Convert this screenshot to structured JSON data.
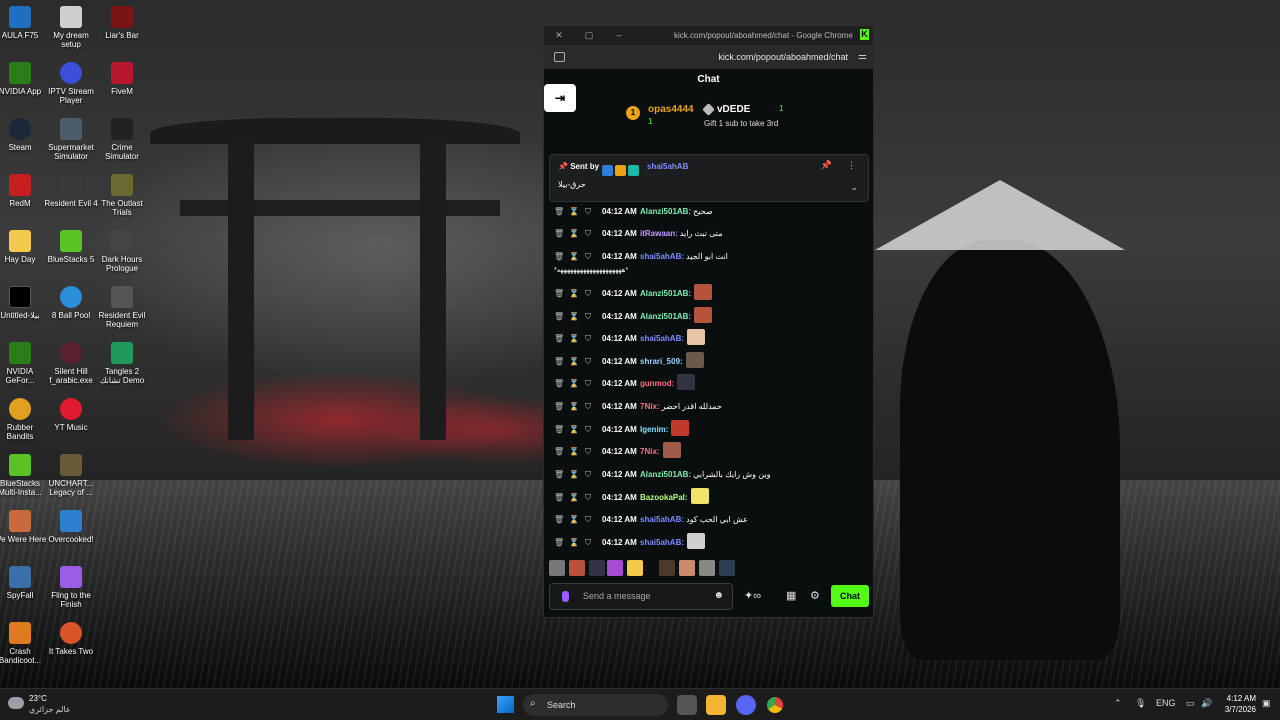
{
  "desktop": {
    "icons": [
      {
        "label": "AULA F75"
      },
      {
        "label": "My dream setup"
      },
      {
        "label": "Liar's Bar"
      },
      {
        "label": "NVIDIA App"
      },
      {
        "label": "IPTV Stream Player"
      },
      {
        "label": "FiveM"
      },
      {
        "label": "Steam"
      },
      {
        "label": "Supermarket Simulator"
      },
      {
        "label": "Crime Simulator"
      },
      {
        "label": "RedM"
      },
      {
        "label": "Resident Evil 4"
      },
      {
        "label": "The Outlast Trials"
      },
      {
        "label": "Hay Day"
      },
      {
        "label": "BlueStacks 5"
      },
      {
        "label": "Dark Hours Prologue"
      },
      {
        "label": "Untitled-بيلا"
      },
      {
        "label": "8 Ball Pool"
      },
      {
        "label": "Resident Evil Requiem"
      },
      {
        "label": "NVIDIA GeFor..."
      },
      {
        "label": "Silent Hill f_arabic.exe"
      },
      {
        "label": "Tangles 2 تشانك Demo"
      },
      {
        "label": "Rubber Bandits"
      },
      {
        "label": "YT Music"
      },
      {
        "label": "BlueStacks Multi-Insta..."
      },
      {
        "label": "UNCHART... Legacy of ..."
      },
      {
        "label": "We Were Here"
      },
      {
        "label": "Overcooked!"
      },
      {
        "label": "SpyFall"
      },
      {
        "label": "Fling to the Finish"
      },
      {
        "label": "Crash Bandicoot..."
      },
      {
        "label": "It Takes Two"
      }
    ]
  },
  "browser": {
    "window_title": "kick.com/popout/aboahmed/chat - Google Chrome",
    "url": "kick.com/popout/aboahmed/chat",
    "kick_logo": "K"
  },
  "chat": {
    "title": "Chat",
    "collapse_icon": "collapse-icon",
    "leaderboard": {
      "first_rank": "1",
      "first_name": "opas4444",
      "first_count": "1",
      "second_name": "vDEDE",
      "second_count": "1",
      "gift_text": "Gift 1 sub to take 3rd"
    },
    "pinned": {
      "sent_by_label": "Sent by",
      "sender": "shai5ahAB",
      "text": "حرق-بيلا"
    },
    "messages": [
      {
        "time": "04:12 AM",
        "user": "Alanzi501AB:",
        "text": "صحيح",
        "color": "#7cf0b0"
      },
      {
        "time": "04:12 AM",
        "user": "itRawaan:",
        "text": "متى تبث رايد",
        "color": "#c59bff"
      },
      {
        "time": "04:12 AM",
        "user": "shai5ahAB:",
        "text": "انت ابو الجيد",
        "color": "#7f8cff"
      },
      {
        "time": "04:12 AM",
        "user": "Alanzi501AB:",
        "text": "",
        "color": "#7cf0b0"
      },
      {
        "time": "04:12 AM",
        "user": "Alanzi501AB:",
        "text": "",
        "color": "#7cf0b0"
      },
      {
        "time": "04:12 AM",
        "user": "shai5ahAB:",
        "text": "",
        "color": "#7f8cff"
      },
      {
        "time": "04:12 AM",
        "user": "shrari_509:",
        "text": "",
        "color": "#9fd3ff"
      },
      {
        "time": "04:12 AM",
        "user": "gunmod:",
        "text": "",
        "color": "#ff6b8b"
      },
      {
        "time": "04:12 AM",
        "user": "7Nix:",
        "text": "حمدلله اقدر احضر",
        "color": "#ff6b8b"
      },
      {
        "time": "04:12 AM",
        "user": "Igenim:",
        "text": "",
        "color": "#7fe0ff"
      },
      {
        "time": "04:12 AM",
        "user": "7Nix:",
        "text": "",
        "color": "#ff6b8b"
      },
      {
        "time": "04:12 AM",
        "user": "Alanzi501AB:",
        "text": "وين وش رايك بالشرابي",
        "color": "#7cf0b0"
      },
      {
        "time": "04:12 AM",
        "user": "BazookaPal:",
        "text": "",
        "color": "#b6ff7a"
      },
      {
        "time": "04:12 AM",
        "user": "shai5ahAB:",
        "text": "عش ابي الحب كود",
        "color": "#7f8cff"
      },
      {
        "time": "04:12 AM",
        "user": "shai5ahAB:",
        "text": "",
        "color": "#7f8cff"
      }
    ],
    "wrapped_line": "*ههههههههههههههههههههه*",
    "composer": {
      "placeholder": "Send a message",
      "send_label": "Chat"
    }
  },
  "taskbar": {
    "temperature": "23°C",
    "location": "عالم جزائري",
    "search_label": "Search",
    "language": "ENG",
    "time": "4:12 AM",
    "date": "3/7/2026"
  },
  "colors": {
    "kick_green": "#53fc18",
    "chat_bg": "#0b0e0f"
  }
}
